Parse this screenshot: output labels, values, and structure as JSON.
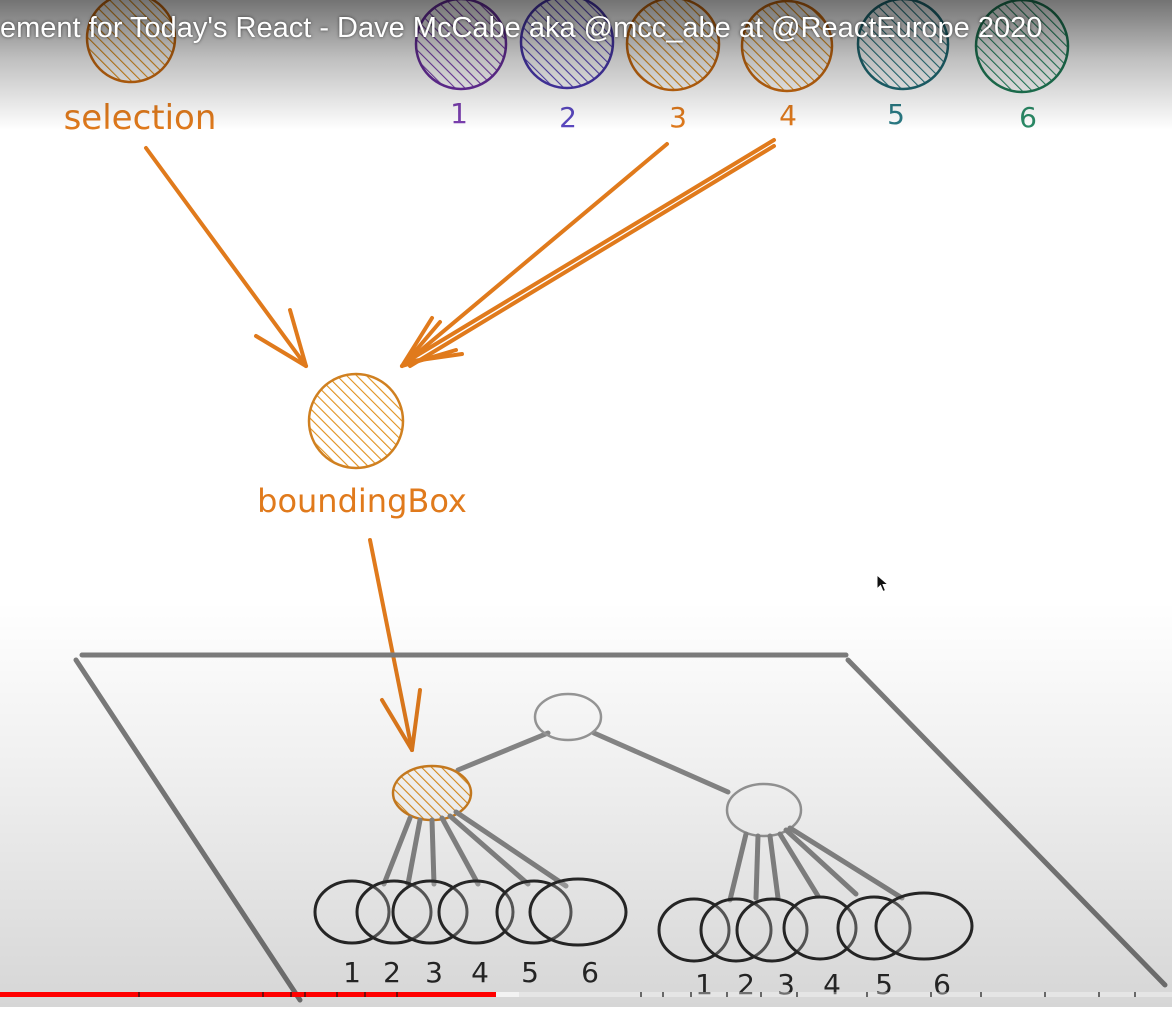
{
  "video": {
    "title": "ement for Today's React - Dave McCabe aka @mcc_abe at @ReactEurope 2020",
    "progress_played": 0.423,
    "progress_buffered": 0.443
  },
  "diagram": {
    "atoms": [
      {
        "label": "selection",
        "color": "#e07a1c"
      },
      {
        "label": "1",
        "color": "#7b3fb0"
      },
      {
        "label": "2",
        "color": "#5a48c0"
      },
      {
        "label": "3",
        "color": "#e07a1c"
      },
      {
        "label": "4",
        "color": "#e07a1c"
      },
      {
        "label": "5",
        "color": "#2a7a84"
      },
      {
        "label": "6",
        "color": "#2a8a66"
      }
    ],
    "selector_label": "boundingBox",
    "selector_color": "#e07a1c",
    "tree_color": "#8a8a8a",
    "leaf_labels_left": [
      "1",
      "2",
      "3",
      "4",
      "5",
      "6"
    ],
    "leaf_labels_right": [
      "1",
      "2",
      "3",
      "4",
      "5",
      "6"
    ]
  },
  "colors": {
    "orange": "#e07a1c",
    "ink": "#222222",
    "gray": "#8a8a8a",
    "progress_red": "#ff0000"
  },
  "icons": {
    "cursor": "mouse-pointer-icon"
  }
}
